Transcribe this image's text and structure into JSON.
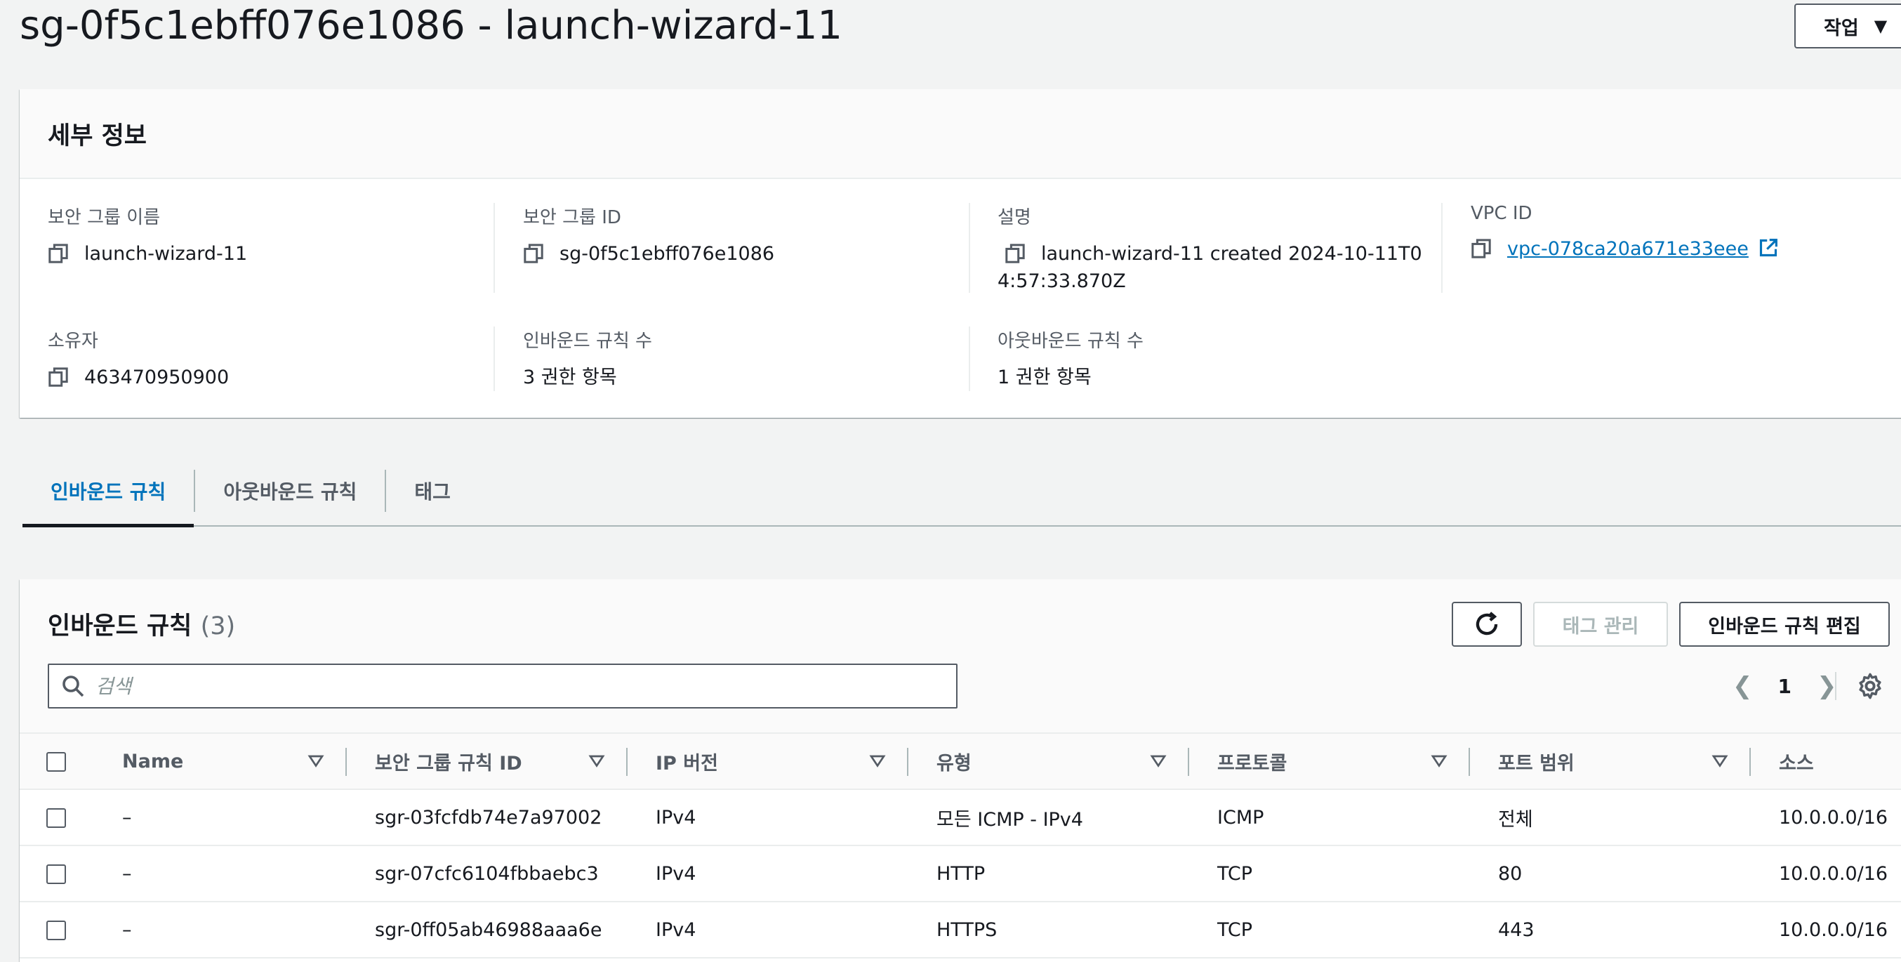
{
  "page": {
    "title": "sg-0f5c1ebff076e1086 - launch-wizard-11",
    "actions_label": "작업"
  },
  "details": {
    "heading": "세부 정보",
    "fields": {
      "sg_name": {
        "label": "보안 그룹 이름",
        "value": "launch-wizard-11"
      },
      "sg_id": {
        "label": "보안 그룹 ID",
        "value": "sg-0f5c1ebff076e1086"
      },
      "description": {
        "label": "설명",
        "value": "launch-wizard-11 created 2024-10-11T04:57:33.870Z"
      },
      "vpc_id": {
        "label": "VPC ID",
        "value": "vpc-078ca20a671e33eee"
      },
      "owner": {
        "label": "소유자",
        "value": "463470950900"
      },
      "inbound_count": {
        "label": "인바운드 규칙 수",
        "value": "3 권한 항목"
      },
      "outbound_count": {
        "label": "아웃바운드 규칙 수",
        "value": "1 권한 항목"
      }
    }
  },
  "tabs": [
    {
      "label": "인바운드 규칙",
      "active": true
    },
    {
      "label": "아웃바운드 규칙",
      "active": false
    },
    {
      "label": "태그",
      "active": false
    }
  ],
  "rules": {
    "title": "인바운드 규칙",
    "count": "(3)",
    "manage_tags_label": "태그 관리",
    "edit_label": "인바운드 규칙 편집",
    "search_placeholder": "검색",
    "page_number": "1",
    "columns": [
      "Name",
      "보안 그룹 규칙 ID",
      "IP 버전",
      "유형",
      "프로토콜",
      "포트 범위",
      "소스"
    ],
    "rows": [
      [
        "–",
        "sgr-03fcfdb74e7a97002",
        "IPv4",
        "모든 ICMP - IPv4",
        "ICMP",
        "전체",
        "10.0.0.0/16"
      ],
      [
        "–",
        "sgr-07cfc6104fbbaebc3",
        "IPv4",
        "HTTP",
        "TCP",
        "80",
        "10.0.0.0/16"
      ],
      [
        "–",
        "sgr-0ff05ab46988aaa6e",
        "IPv4",
        "HTTPS",
        "TCP",
        "443",
        "10.0.0.0/16"
      ]
    ]
  },
  "colors": {
    "link": "#0073bb",
    "text": "#16191f",
    "muted": "#545b64",
    "background": "#f2f3f3"
  },
  "icons": [
    "copy-icon",
    "external-link-icon",
    "refresh-icon",
    "search-icon",
    "chevron-left-icon",
    "chevron-right-icon",
    "gear-icon",
    "sort-icon",
    "caret-down-icon"
  ]
}
